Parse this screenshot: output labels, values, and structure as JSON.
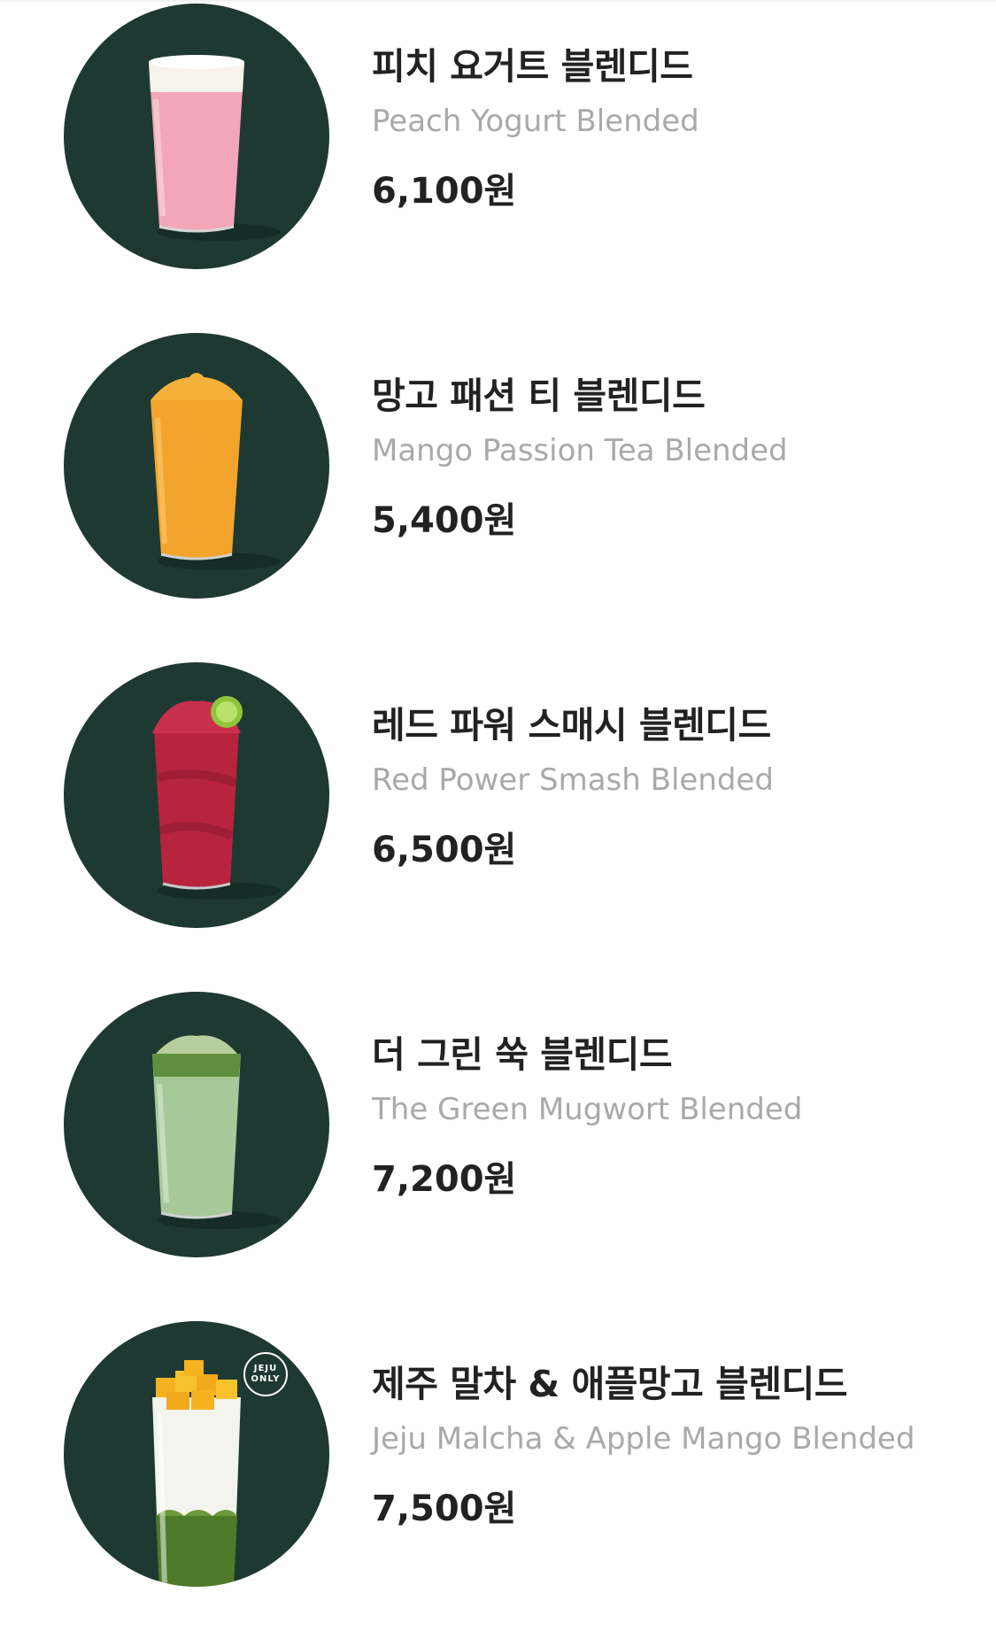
{
  "menu": {
    "items": [
      {
        "name_ko": "피치 요거트 블렌디드",
        "name_en": "Peach Yogurt Blended",
        "price": "6,100원"
      },
      {
        "name_ko": "망고 패션 티 블렌디드",
        "name_en": "Mango Passion Tea Blended",
        "price": "5,400원"
      },
      {
        "name_ko": "레드 파워 스매시 블렌디드",
        "name_en": "Red Power Smash Blended",
        "price": "6,500원"
      },
      {
        "name_ko": "더 그린 쑥 블렌디드",
        "name_en": "The Green Mugwort Blended",
        "price": "7,200원"
      },
      {
        "name_ko": "제주 말차 & 애플망고 블렌디드",
        "name_en": "Jeju Malcha & Apple Mango Blended",
        "price": "7,500원",
        "badge_line1": "JEJU",
        "badge_line2": "ONLY"
      }
    ]
  },
  "colors": {
    "thumb_background": "#1e3932",
    "title_text": "#222222",
    "subtitle_text": "#a9a9a9"
  }
}
